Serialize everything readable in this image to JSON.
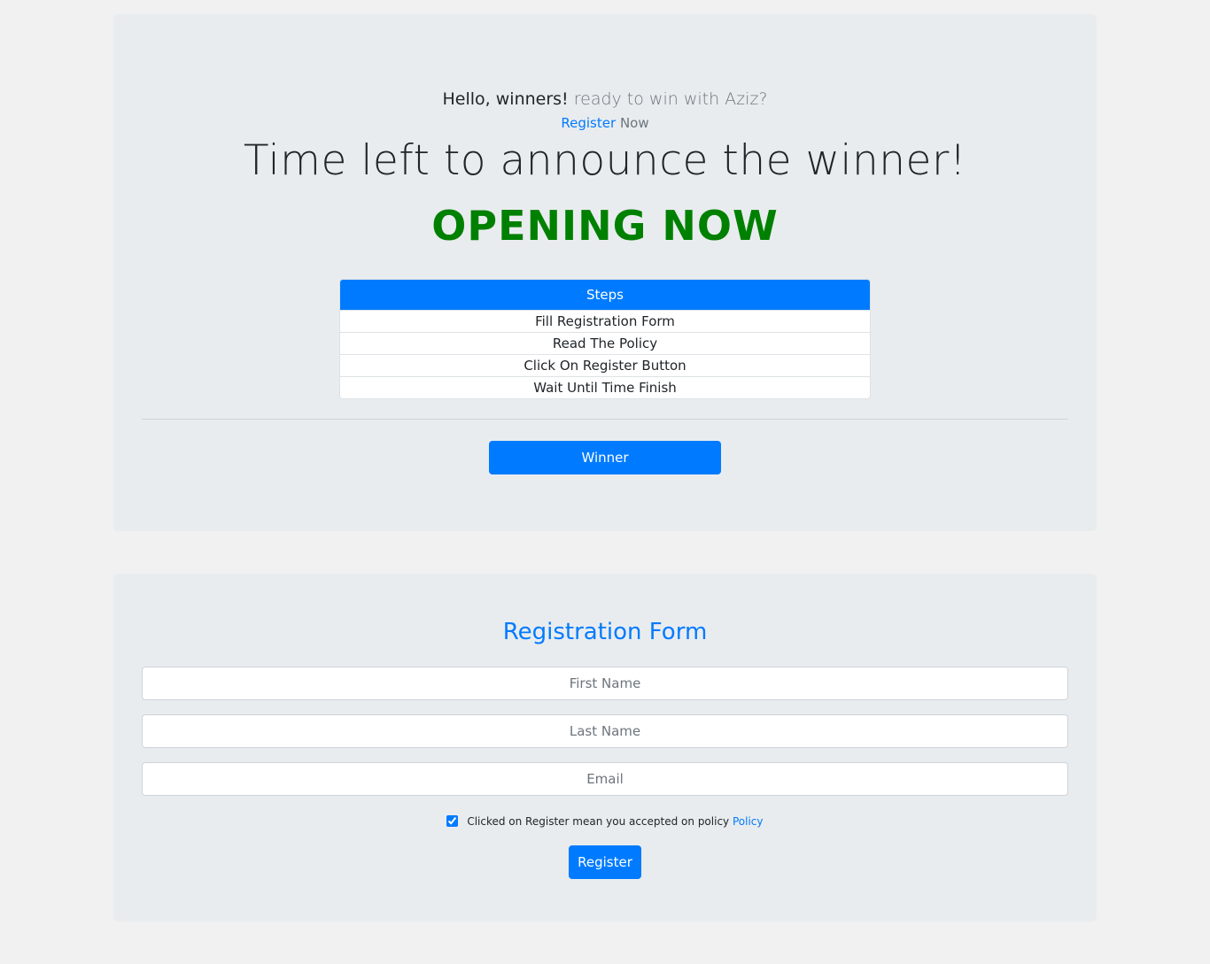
{
  "hero": {
    "greeting_strong": "Hello, winners!",
    "greeting_muted": "ready to win with Aziz?",
    "register_link": "Register",
    "register_suffix": "Now",
    "title": "Time left to announce the winner!",
    "status": "OPENING NOW",
    "steps": {
      "header": "Steps",
      "items": [
        "Fill Registration Form",
        "Read The Policy",
        "Click On Register Button",
        "Wait Until Time Finish"
      ]
    },
    "winner_button": "Winner"
  },
  "registration": {
    "title": "Registration Form",
    "first_name_placeholder": "First Name",
    "last_name_placeholder": "Last Name",
    "email_placeholder": "Email",
    "policy_text": "Clicked on Register mean you accepted on policy",
    "policy_link": "Policy",
    "policy_checked": true,
    "register_button": "Register"
  },
  "colors": {
    "primary": "#007bff",
    "status": "#008000",
    "panel": "#e9ecef",
    "background": "#f1f1f1"
  }
}
